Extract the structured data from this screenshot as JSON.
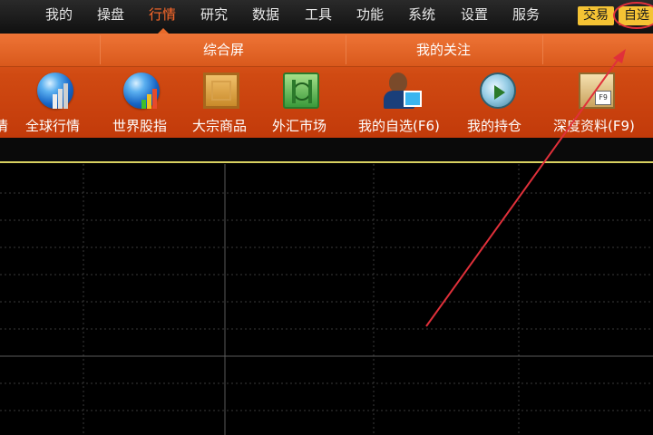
{
  "menu": {
    "items": [
      {
        "id": "wode",
        "label": "我的"
      },
      {
        "id": "caopan",
        "label": "操盘"
      },
      {
        "id": "hangqing",
        "label": "行情",
        "active": true
      },
      {
        "id": "yanjiu",
        "label": "研究"
      },
      {
        "id": "shuju",
        "label": "数据"
      },
      {
        "id": "gongju",
        "label": "工具"
      },
      {
        "id": "gongneng",
        "label": "功能"
      },
      {
        "id": "xitong",
        "label": "系统"
      },
      {
        "id": "shezhi",
        "label": "设置"
      },
      {
        "id": "fuwu",
        "label": "服务"
      }
    ],
    "trade_button": "交易",
    "watchlist_button": "自选"
  },
  "toolbar": {
    "groups": [
      "综合屏",
      "我的关注"
    ],
    "cut_label": "情",
    "tools": [
      {
        "label": "全球行情",
        "icon": "globe-bars-icon"
      },
      {
        "label": "世界股指",
        "icon": "globe-chart-icon"
      },
      {
        "label": "大宗商品",
        "icon": "crate-icon"
      },
      {
        "label": "外汇市场",
        "icon": "money-icon"
      },
      {
        "label": "我的自选(F6)",
        "icon": "person-monitor-icon"
      },
      {
        "label": "我的持仓",
        "icon": "gauge-arrow-icon"
      },
      {
        "label": "深度资料(F9)",
        "icon": "document-f9-icon"
      }
    ]
  },
  "colors": {
    "accent": "#e86a2a",
    "menu_active": "#ff6a2a",
    "button_yellow": "#f5c334",
    "annotation_red": "#e0303a",
    "grid": "#3a3a3a"
  }
}
